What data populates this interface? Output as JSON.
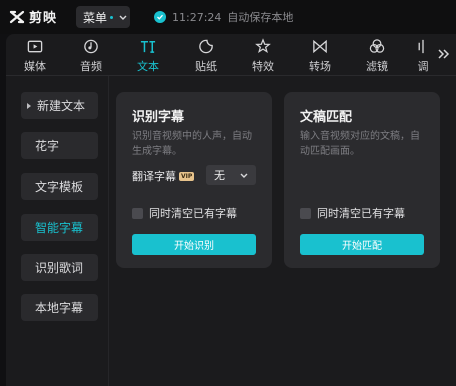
{
  "app": {
    "name": "剪映"
  },
  "titlebar": {
    "menu_label": "菜单",
    "save_time": "11:27:24",
    "save_text": "自动保存本地"
  },
  "toolbar": {
    "items": [
      {
        "label": "媒体",
        "icon": "media-icon",
        "active": false
      },
      {
        "label": "音频",
        "icon": "audio-icon",
        "active": false
      },
      {
        "label": "文本",
        "icon": "text-icon",
        "active": true
      },
      {
        "label": "贴纸",
        "icon": "sticker-icon",
        "active": false
      },
      {
        "label": "特效",
        "icon": "effects-icon",
        "active": false
      },
      {
        "label": "转场",
        "icon": "transition-icon",
        "active": false
      },
      {
        "label": "滤镜",
        "icon": "filter-icon",
        "active": false
      },
      {
        "label": "调",
        "icon": "adjust-icon",
        "active": false
      }
    ],
    "more_icon": "double-chevron-right-icon"
  },
  "sidebar": {
    "items": [
      {
        "label": "新建文本",
        "active": false
      },
      {
        "label": "花字",
        "active": false
      },
      {
        "label": "文字模板",
        "active": false
      },
      {
        "label": "智能字幕",
        "active": true
      },
      {
        "label": "识别歌词",
        "active": false
      },
      {
        "label": "本地字幕",
        "active": false
      }
    ]
  },
  "cards": {
    "recognize": {
      "title": "识别字幕",
      "desc": "识别音视频中的人声，自动生成字幕。",
      "translate_label": "翻译字幕",
      "vip_label": "VIP",
      "translate_value": "无",
      "checkbox_label": "同时清空已有字幕",
      "button_label": "开始识别"
    },
    "match": {
      "title": "文稿匹配",
      "desc": "输入音视频对应的文稿，自动匹配画面。",
      "checkbox_label": "同时清空已有字幕",
      "button_label": "开始匹配"
    }
  },
  "colors": {
    "accent": "#19c1cf",
    "background": "#101012",
    "panel": "#1b1b1d",
    "card": "#2b2b2e"
  }
}
